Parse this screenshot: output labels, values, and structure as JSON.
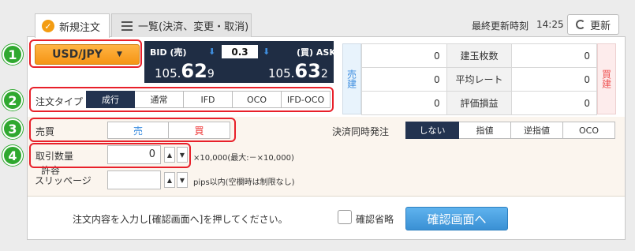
{
  "tabs": {
    "new_order": "新規注文",
    "list": "一覧(決済、変更・取消)"
  },
  "header": {
    "last_update_label": "最終更新時刻",
    "last_update_time": "14:25",
    "refresh_label": "更新"
  },
  "currency_pair": {
    "selected": "USD/JPY"
  },
  "rate": {
    "bid_label": "BID (売)",
    "ask_label": "(買) ASK",
    "spread": "0.3",
    "bid_int": "105.",
    "bid_big": "62",
    "bid_sub": "9",
    "ask_int": "105.",
    "ask_big": "63",
    "ask_sub": "2"
  },
  "positions": {
    "sell_label": "売建",
    "buy_label": "買建",
    "rows": [
      {
        "sell": "0",
        "label": "建玉枚数",
        "buy": "0"
      },
      {
        "sell": "0",
        "label": "平均レート",
        "buy": "0"
      },
      {
        "sell": "0",
        "label": "評価損益",
        "buy": "0"
      }
    ]
  },
  "order_type": {
    "label": "注文タイプ",
    "options": [
      "成行",
      "通常",
      "IFD",
      "OCO",
      "IFD-OCO"
    ],
    "selected": "成行"
  },
  "side": {
    "label": "売買",
    "sell": "売",
    "buy": "買"
  },
  "settle": {
    "label": "決済同時発注",
    "options": [
      "しない",
      "指値",
      "逆指値",
      "OCO"
    ],
    "selected": "しない"
  },
  "quantity": {
    "label": "取引数量",
    "value": "0",
    "note": "×10,000(最大:－×10,000)"
  },
  "slippage": {
    "label_line1": "許容",
    "label_line2": "スリッページ",
    "value": "",
    "note": "pips以内(空欄時は制限なし)"
  },
  "footer": {
    "instruction": "注文内容を入力し[確認画面へ]を押してください。",
    "skip_confirm_label": "確認省略",
    "confirm_button": "確認画面へ"
  },
  "annotations": [
    "1",
    "2",
    "3",
    "4"
  ],
  "colors": {
    "accent_orange": "#f39c12",
    "rate_bg": "#1f2d44",
    "active_seg": "#233350",
    "confirm_blue": "#3a90d4",
    "highlight_red": "#e8202a",
    "badge_green": "#2fa82f"
  }
}
